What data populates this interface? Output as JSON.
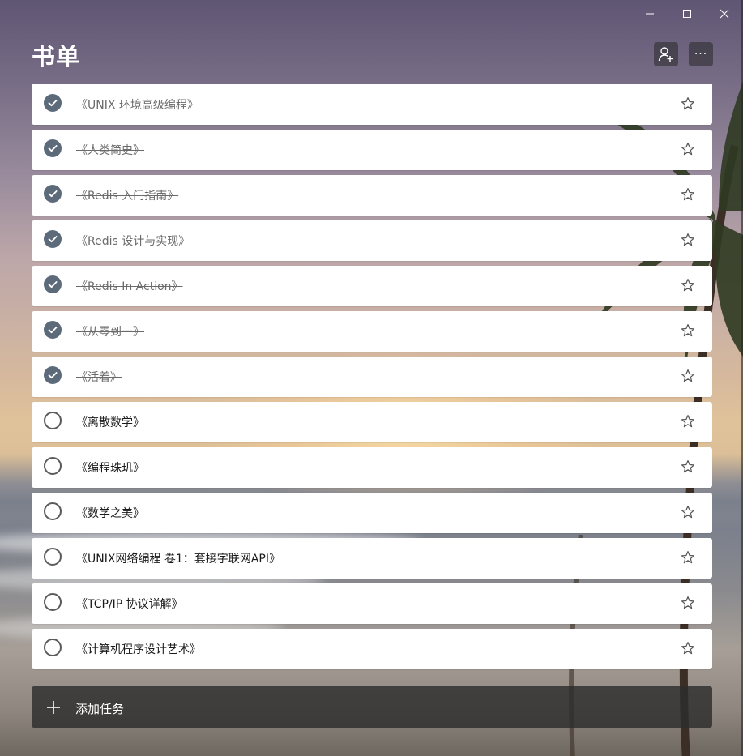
{
  "header": {
    "title": "书单",
    "share_icon": "person-add-icon",
    "more_icon": "more-icon",
    "more_label": "···"
  },
  "window": {
    "minimize_icon": "minimize-icon",
    "maximize_icon": "maximize-icon",
    "close_icon": "close-icon"
  },
  "tasks": [
    {
      "title": "《UNIX 环境高级编程》",
      "done": true
    },
    {
      "title": "《人类简史》",
      "done": true
    },
    {
      "title": "《Redis 入门指南》",
      "done": true
    },
    {
      "title": "《Redis 设计与实现》",
      "done": true
    },
    {
      "title": "《Redis In Action》",
      "done": true
    },
    {
      "title": "《从零到一》",
      "done": true
    },
    {
      "title": "《活着》",
      "done": true
    },
    {
      "title": "《离散数学》",
      "done": false
    },
    {
      "title": "《编程珠玑》",
      "done": false
    },
    {
      "title": "《数学之美》",
      "done": false
    },
    {
      "title": "《UNIX网络编程 卷1：套接字联网API》",
      "done": false
    },
    {
      "title": "《TCP/IP 协议详解》",
      "done": false
    },
    {
      "title": "《计算机程序设计艺术》",
      "done": false
    }
  ],
  "add_task": {
    "label": "添加任务",
    "icon": "plus-icon"
  },
  "colors": {
    "checked": "#5c6a7a",
    "row_bg": "#ffffff",
    "add_bar_bg": "#2d2d2d"
  }
}
